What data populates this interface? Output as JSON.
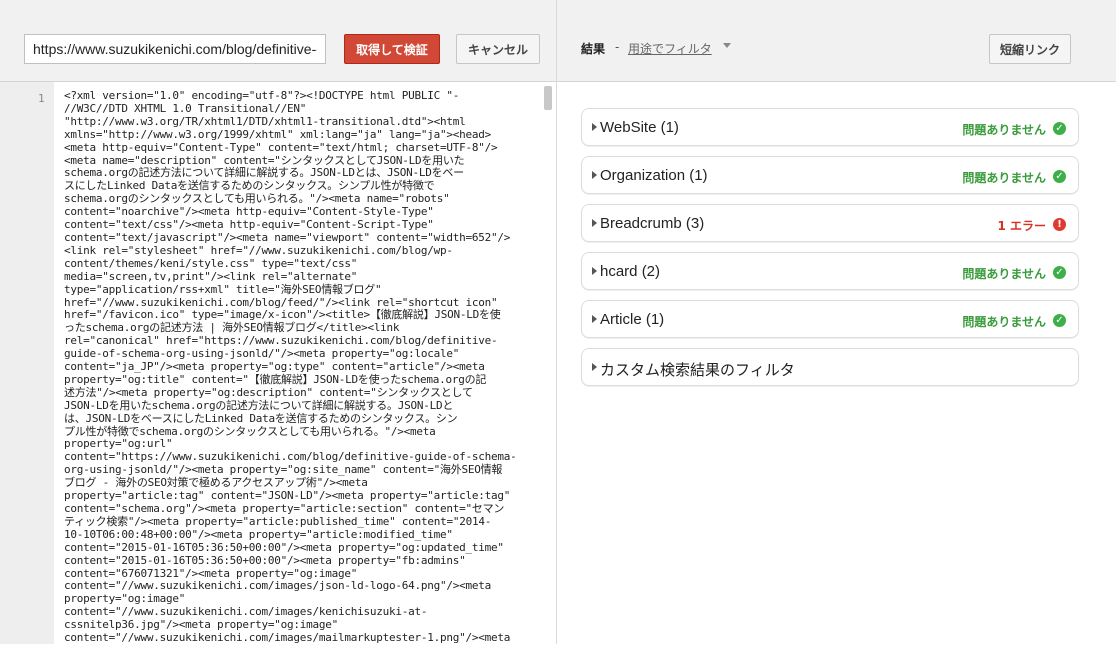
{
  "toolbar": {
    "url_value": "https://www.suzukikenichi.com/blog/definitive-guide-of-schema-org-using-jsonld/",
    "fetch_label": "取得して検証",
    "cancel_label": "キャンセル"
  },
  "editor": {
    "line_number": "1",
    "code": "<?xml version=\"1.0\" encoding=\"utf-8\"?><!DOCTYPE html PUBLIC \"-\n//W3C//DTD XHTML 1.0 Transitional//EN\"\n\"http://www.w3.org/TR/xhtml1/DTD/xhtml1-transitional.dtd\"><html\nxmlns=\"http://www.w3.org/1999/xhtml\" xml:lang=\"ja\" lang=\"ja\"><head>\n<meta http-equiv=\"Content-Type\" content=\"text/html; charset=UTF-8\"/>\n<meta name=\"description\" content=\"シンタックスとしてJSON-LDを用いた\nschema.orgの記述方法について詳細に解説する。JSON-LDとは、JSON-LDをベー\nスにしたLinked Dataを送信するためのシンタックス。シンプル性が特徴で\nschema.orgのシンタックスとしても用いられる。\"/><meta name=\"robots\"\ncontent=\"noarchive\"/><meta http-equiv=\"Content-Style-Type\"\ncontent=\"text/css\"/><meta http-equiv=\"Content-Script-Type\"\ncontent=\"text/javascript\"/><meta name=\"viewport\" content=\"width=652\"/>\n<link rel=\"stylesheet\" href=\"//www.suzukikenichi.com/blog/wp-\ncontent/themes/keni/style.css\" type=\"text/css\"\nmedia=\"screen,tv,print\"/><link rel=\"alternate\"\ntype=\"application/rss+xml\" title=\"海外SEO情報ブログ\"\nhref=\"//www.suzukikenichi.com/blog/feed/\"/><link rel=\"shortcut icon\"\nhref=\"/favicon.ico\" type=\"image/x-icon\"/><title>【徹底解説】JSON-LDを使\nったschema.orgの記述方法 | 海外SEO情報ブログ</title><link\nrel=\"canonical\" href=\"https://www.suzukikenichi.com/blog/definitive-\nguide-of-schema-org-using-jsonld/\"/><meta property=\"og:locale\"\ncontent=\"ja_JP\"/><meta property=\"og:type\" content=\"article\"/><meta\nproperty=\"og:title\" content=\"【徹底解説】JSON-LDを使ったschema.orgの記\n述方法\"/><meta property=\"og:description\" content=\"シンタックスとして\nJSON-LDを用いたschema.orgの記述方法について詳細に解説する。JSON-LDと\nは、JSON-LDをベースにしたLinked Dataを送信するためのシンタックス。シン\nプル性が特徴でschema.orgのシンタックスとしても用いられる。\"/><meta\nproperty=\"og:url\"\ncontent=\"https://www.suzukikenichi.com/blog/definitive-guide-of-schema-\norg-using-jsonld/\"/><meta property=\"og:site_name\" content=\"海外SEO情報\nブログ - 海外のSEO対策で極めるアクセスアップ術\"/><meta\nproperty=\"article:tag\" content=\"JSON-LD\"/><meta property=\"article:tag\"\ncontent=\"schema.org\"/><meta property=\"article:section\" content=\"セマン\nティック検索\"/><meta property=\"article:published_time\" content=\"2014-\n10-10T06:00:48+00:00\"/><meta property=\"article:modified_time\"\ncontent=\"2015-01-16T05:36:50+00:00\"/><meta property=\"og:updated_time\"\ncontent=\"2015-01-16T05:36:50+00:00\"/><meta property=\"fb:admins\"\ncontent=\"676071321\"/><meta property=\"og:image\"\ncontent=\"//www.suzukikenichi.com/images/json-ld-logo-64.png\"/><meta\nproperty=\"og:image\"\ncontent=\"//www.suzukikenichi.com/images/kenichisuzuki-at-\ncssnitelp36.jpg\"/><meta property=\"og:image\"\ncontent=\"//www.suzukikenichi.com/images/mailmarkuptester-1.png\"/><meta"
  },
  "results": {
    "label": "結果",
    "separator": "-",
    "filter_label": "用途でフィルタ",
    "short_link_label": "短縮リンク",
    "items": [
      {
        "title": "WebSite (1)",
        "status": "問題ありません",
        "state": "ok"
      },
      {
        "title": "Organization (1)",
        "status": "問題ありません",
        "state": "ok"
      },
      {
        "title": "Breadcrumb (3)",
        "status": "1 エラー",
        "state": "error"
      },
      {
        "title": "hcard (2)",
        "status": "問題ありません",
        "state": "ok"
      },
      {
        "title": "Article (1)",
        "status": "問題ありません",
        "state": "ok"
      },
      {
        "title": "カスタム検索結果のフィルタ",
        "status": "",
        "state": "none"
      }
    ]
  },
  "colors": {
    "accent_red": "#d14836",
    "ok_green": "#3a9c3c",
    "error_red": "#d93025"
  },
  "icons": {
    "ok": "check-circle-icon",
    "error": "exclamation-circle-icon",
    "expand": "caret-right-icon",
    "dropdown": "caret-down-icon"
  }
}
